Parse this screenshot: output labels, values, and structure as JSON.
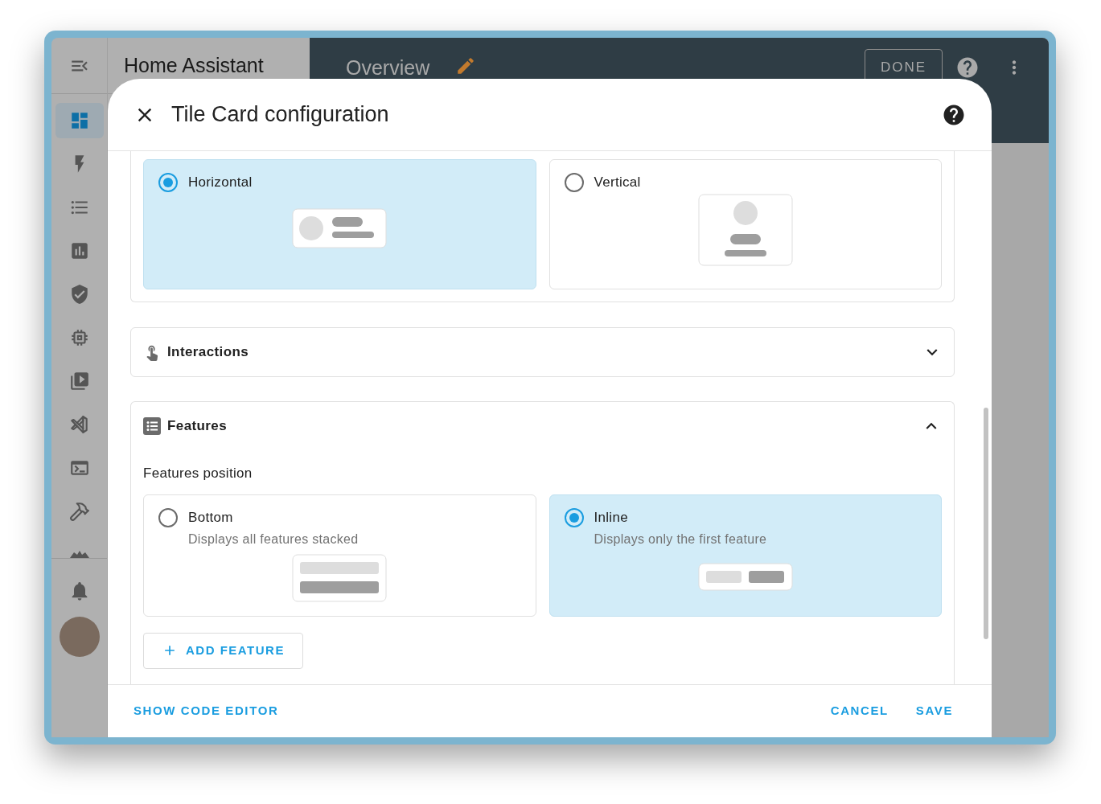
{
  "app": {
    "title": "Home Assistant",
    "page_title": "Overview",
    "done_button": "DONE"
  },
  "sidebar": {
    "items": [
      {
        "kind": "dashboard",
        "selected": true
      },
      {
        "kind": "energy",
        "selected": false
      },
      {
        "kind": "logbook",
        "selected": false
      },
      {
        "kind": "history",
        "selected": false
      },
      {
        "kind": "security",
        "selected": false
      },
      {
        "kind": "hardware",
        "selected": false
      },
      {
        "kind": "media",
        "selected": false
      },
      {
        "kind": "code",
        "selected": false
      },
      {
        "kind": "terminal",
        "selected": false
      },
      {
        "kind": "tools",
        "selected": false
      },
      {
        "kind": "partial",
        "selected": false
      }
    ]
  },
  "dialog": {
    "title": "Tile Card configuration",
    "layout_options": [
      {
        "label": "Horizontal",
        "kind": "horizontal",
        "selected": true
      },
      {
        "label": "Vertical",
        "kind": "vertical",
        "selected": false
      }
    ],
    "interactions": {
      "title": "Interactions",
      "expanded": false
    },
    "features": {
      "title": "Features",
      "expanded": true,
      "position_label": "Features position",
      "options": [
        {
          "label": "Bottom",
          "description": "Displays all features stacked",
          "kind": "bottom",
          "selected": false
        },
        {
          "label": "Inline",
          "description": "Displays only the first feature",
          "kind": "inline",
          "selected": true
        }
      ],
      "add_button": "ADD FEATURE"
    },
    "footer": {
      "code_editor_button": "SHOW CODE EDITOR",
      "cancel_button": "CANCEL",
      "save_button": "SAVE"
    }
  }
}
